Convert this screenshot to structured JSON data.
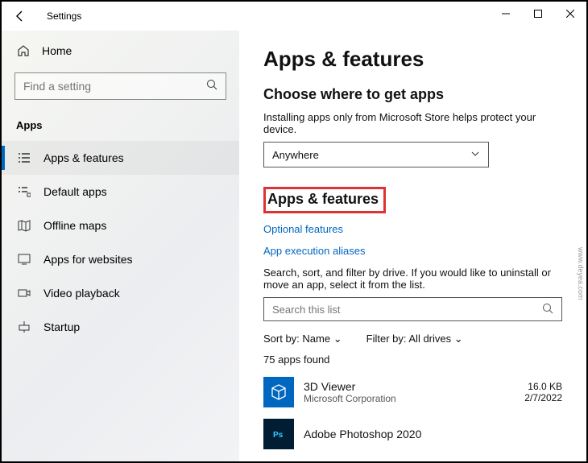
{
  "titlebar": {
    "title": "Settings"
  },
  "sidebar": {
    "home_label": "Home",
    "search_placeholder": "Find a setting",
    "category": "Apps",
    "items": [
      {
        "label": "Apps & features"
      },
      {
        "label": "Default apps"
      },
      {
        "label": "Offline maps"
      },
      {
        "label": "Apps for websites"
      },
      {
        "label": "Video playback"
      },
      {
        "label": "Startup"
      }
    ]
  },
  "main": {
    "page_title": "Apps & features",
    "choose_heading": "Choose where to get apps",
    "choose_desc": "Installing apps only from Microsoft Store helps protect your device.",
    "source_dropdown_value": "Anywhere",
    "section_heading": "Apps & features",
    "link_optional": "Optional features",
    "link_aliases": "App execution aliases",
    "search_desc": "Search, sort, and filter by drive. If you would like to uninstall or move an app, select it from the list.",
    "search_placeholder": "Search this list",
    "sort_label": "Sort by:",
    "sort_value": "Name",
    "filter_label": "Filter by:",
    "filter_value": "All drives",
    "count_text": "75 apps found",
    "apps": [
      {
        "name": "3D Viewer",
        "publisher": "Microsoft Corporation",
        "size": "16.0 KB",
        "date": "2/7/2022"
      },
      {
        "name": "Adobe Photoshop 2020",
        "publisher": "",
        "size": "",
        "date": ""
      }
    ]
  },
  "watermark": "www.deyea.com"
}
